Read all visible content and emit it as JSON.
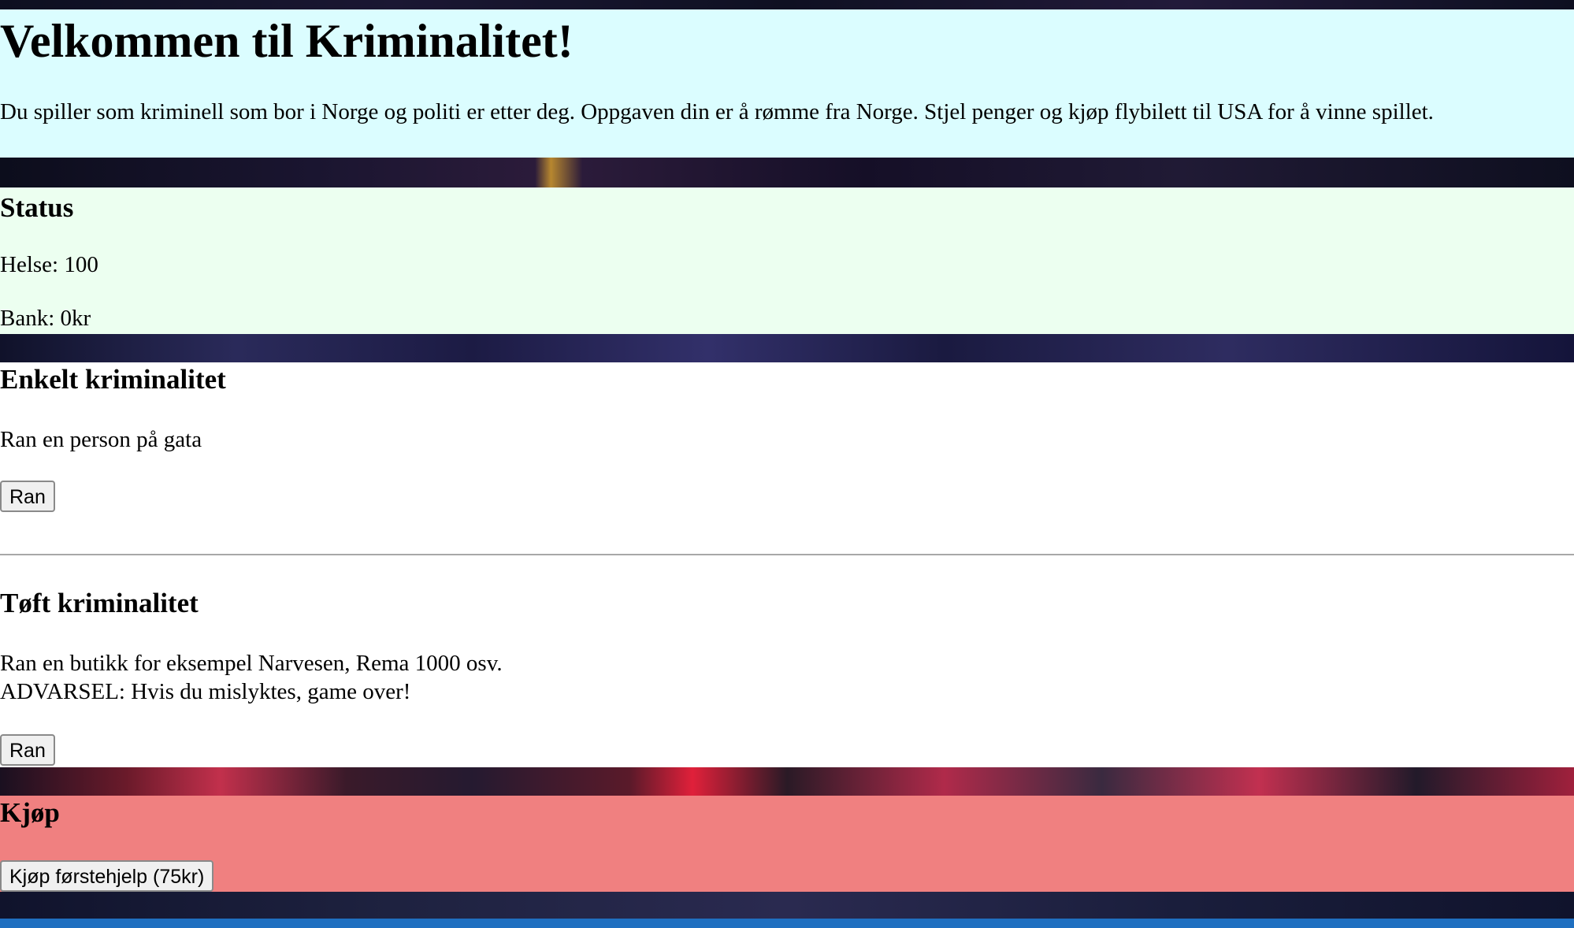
{
  "intro": {
    "title": "Velkommen til Kriminalitet!",
    "description": "Du spiller som kriminell som bor i Norge og politi er etter deg. Oppgaven din er å rømme fra Norge. Stjel penger og kjøp flybilett til USA for å vinne spillet."
  },
  "status": {
    "heading": "Status",
    "health": "Helse: 100",
    "bank": "Bank: 0kr"
  },
  "simple_crime": {
    "heading": "Enkelt kriminalitet",
    "description": "Ran en person på gata",
    "button_label": "Ran"
  },
  "tough_crime": {
    "heading": "Tøft kriminalitet",
    "description_line1": "Ran en butikk for eksempel Narvesen, Rema 1000 osv.",
    "description_line2": "ADVARSEL: Hvis du mislyktes, game over!",
    "button_label": "Ran"
  },
  "shop": {
    "heading": "Kjøp",
    "buy_first_aid_label": "Kjøp førstehjelp (75kr)"
  },
  "colors": {
    "intro_bg": "#dbfdff",
    "status_bg": "#ecfff0",
    "crime_bg": "#ffffff",
    "shop_bg": "#f08080"
  }
}
